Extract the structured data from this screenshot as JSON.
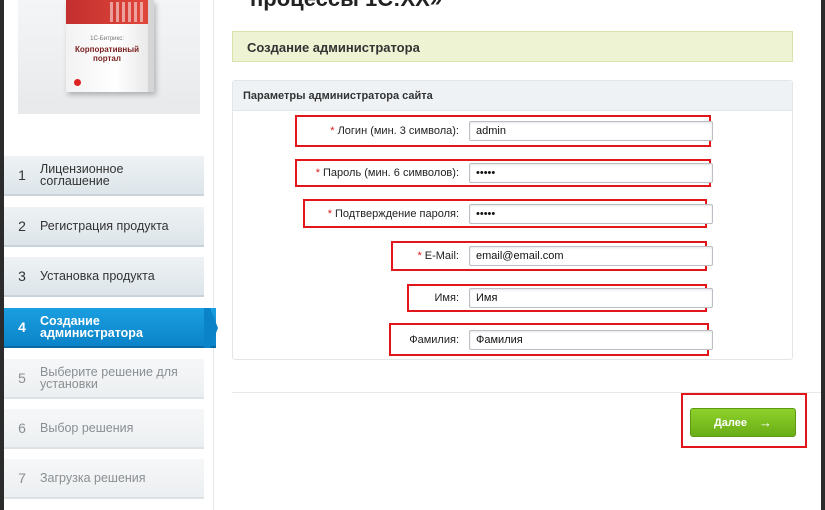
{
  "page_title": "процессы 1С:ХХ»",
  "product_box": {
    "brand": "1С-Битрикс:",
    "title_line1": "Корпоративный",
    "title_line2": "портал"
  },
  "steps": [
    {
      "num": "1",
      "label": "Лицензионное соглашение",
      "state": "done"
    },
    {
      "num": "2",
      "label": "Регистрация продукта",
      "state": "done"
    },
    {
      "num": "3",
      "label": "Установка продукта",
      "state": "done"
    },
    {
      "num": "4",
      "label": "Создание администратора",
      "state": "active"
    },
    {
      "num": "5",
      "label": "Выберите решение для установки",
      "state": "disabled"
    },
    {
      "num": "6",
      "label": "Выбор решения",
      "state": "disabled"
    },
    {
      "num": "7",
      "label": "Загрузка решения",
      "state": "disabled"
    }
  ],
  "section_title": "Создание администратора",
  "panel_title": "Параметры администратора сайта",
  "form": {
    "login": {
      "required": "*",
      "label": "Логин (мин. 3 символа):",
      "value": "admin"
    },
    "password": {
      "required": "*",
      "label": "Пароль (мин. 6 символов):",
      "value": "•••••"
    },
    "confirm": {
      "required": "*",
      "label": "Подтверждение пароля:",
      "value": "•••••"
    },
    "email": {
      "required": "*",
      "label": "E-Mail:",
      "value": "email@email.com"
    },
    "name": {
      "label": "Имя:",
      "value": "Имя"
    },
    "lastname": {
      "label": "Фамилия:",
      "value": "Фамилия"
    }
  },
  "next_button": {
    "label": "Далее",
    "arrow": "→"
  },
  "colors": {
    "active_step": "#0b83c8",
    "next_button": "#6fb31a",
    "highlight": "#e0161b",
    "section_header": "#eef3d3"
  }
}
